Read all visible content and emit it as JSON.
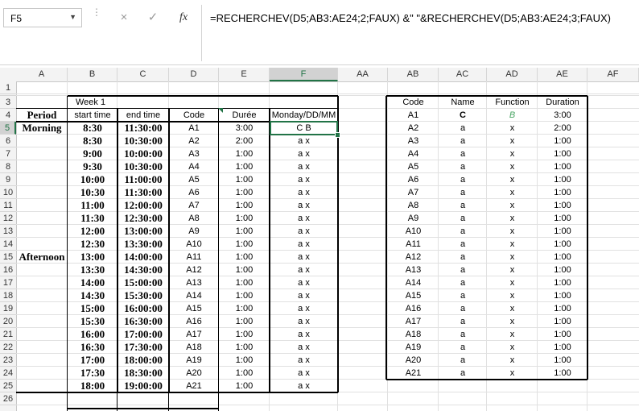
{
  "formula_bar": {
    "name_box": "F5",
    "cancel_icon": "×",
    "enter_icon": "✓",
    "fx_label": "fx",
    "formula": "=RECHERCHEV(D5;AB3:AE24;2;FAUX) &\"  \"&RECHERCHEV(D5;AB3:AE24;3;FAUX)"
  },
  "columns": [
    "A",
    "B",
    "C",
    "D",
    "E",
    "F",
    "AA",
    "AB",
    "AC",
    "AD",
    "AE",
    "AF"
  ],
  "rows": [
    "1",
    "2",
    "3",
    "4",
    "5",
    "6",
    "7",
    "8",
    "9",
    "10",
    "11",
    "12",
    "13",
    "14",
    "15",
    "16",
    "17",
    "18",
    "19",
    "20",
    "21",
    "22",
    "23",
    "24",
    "25",
    "26"
  ],
  "selected_cell": {
    "column": "F",
    "row": "5"
  },
  "schedule": {
    "week_label": "Week 1",
    "headers": {
      "period": "Period",
      "start": "start time",
      "end": "end time",
      "code": "Code",
      "duration": "Durée",
      "day": "Monday/DD/MM"
    },
    "period_labels": [
      {
        "row": "5",
        "label": "Morning"
      },
      {
        "row": "15",
        "label": "Afternoon"
      }
    ],
    "rows": [
      {
        "start": "8:30",
        "end": "11:30:00",
        "code": "A1",
        "duration": "3:00",
        "value": "C B"
      },
      {
        "start": "8:30",
        "end": "10:30:00",
        "code": "A2",
        "duration": "2:00",
        "value": "a x"
      },
      {
        "start": "9:00",
        "end": "10:00:00",
        "code": "A3",
        "duration": "1:00",
        "value": "a x"
      },
      {
        "start": "9:30",
        "end": "10:30:00",
        "code": "A4",
        "duration": "1:00",
        "value": "a x"
      },
      {
        "start": "10:00",
        "end": "11:00:00",
        "code": "A5",
        "duration": "1:00",
        "value": "a x"
      },
      {
        "start": "10:30",
        "end": "11:30:00",
        "code": "A6",
        "duration": "1:00",
        "value": "a x"
      },
      {
        "start": "11:00",
        "end": "12:00:00",
        "code": "A7",
        "duration": "1:00",
        "value": "a x"
      },
      {
        "start": "11:30",
        "end": "12:30:00",
        "code": "A8",
        "duration": "1:00",
        "value": "a x"
      },
      {
        "start": "12:00",
        "end": "13:00:00",
        "code": "A9",
        "duration": "1:00",
        "value": "a x"
      },
      {
        "start": "12:30",
        "end": "13:30:00",
        "code": "A10",
        "duration": "1:00",
        "value": "a x"
      },
      {
        "start": "13:00",
        "end": "14:00:00",
        "code": "A11",
        "duration": "1:00",
        "value": "a x"
      },
      {
        "start": "13:30",
        "end": "14:30:00",
        "code": "A12",
        "duration": "1:00",
        "value": "a x"
      },
      {
        "start": "14:00",
        "end": "15:00:00",
        "code": "A13",
        "duration": "1:00",
        "value": "a x"
      },
      {
        "start": "14:30",
        "end": "15:30:00",
        "code": "A14",
        "duration": "1:00",
        "value": "a x"
      },
      {
        "start": "15:00",
        "end": "16:00:00",
        "code": "A15",
        "duration": "1:00",
        "value": "a x"
      },
      {
        "start": "15:30",
        "end": "16:30:00",
        "code": "A16",
        "duration": "1:00",
        "value": "a x"
      },
      {
        "start": "16:00",
        "end": "17:00:00",
        "code": "A17",
        "duration": "1:00",
        "value": "a x"
      },
      {
        "start": "16:30",
        "end": "17:30:00",
        "code": "A18",
        "duration": "1:00",
        "value": "a x"
      },
      {
        "start": "17:00",
        "end": "18:00:00",
        "code": "A19",
        "duration": "1:00",
        "value": "a x"
      },
      {
        "start": "17:30",
        "end": "18:30:00",
        "code": "A20",
        "duration": "1:00",
        "value": "a x"
      },
      {
        "start": "18:00",
        "end": "19:00:00",
        "code": "A21",
        "duration": "1:00",
        "value": "a x"
      }
    ]
  },
  "lookup": {
    "headers": {
      "code": "Code",
      "name": "Name",
      "function": "Function",
      "duration": "Duration"
    },
    "rows": [
      {
        "code": "A1",
        "name": "C",
        "function": "B",
        "duration": "3:00"
      },
      {
        "code": "A2",
        "name": "a",
        "function": "x",
        "duration": "2:00"
      },
      {
        "code": "A3",
        "name": "a",
        "function": "x",
        "duration": "1:00"
      },
      {
        "code": "A4",
        "name": "a",
        "function": "x",
        "duration": "1:00"
      },
      {
        "code": "A5",
        "name": "a",
        "function": "x",
        "duration": "1:00"
      },
      {
        "code": "A6",
        "name": "a",
        "function": "x",
        "duration": "1:00"
      },
      {
        "code": "A7",
        "name": "a",
        "function": "x",
        "duration": "1:00"
      },
      {
        "code": "A8",
        "name": "a",
        "function": "x",
        "duration": "1:00"
      },
      {
        "code": "A9",
        "name": "a",
        "function": "x",
        "duration": "1:00"
      },
      {
        "code": "A10",
        "name": "a",
        "function": "x",
        "duration": "1:00"
      },
      {
        "code": "A11",
        "name": "a",
        "function": "x",
        "duration": "1:00"
      },
      {
        "code": "A12",
        "name": "a",
        "function": "x",
        "duration": "1:00"
      },
      {
        "code": "A13",
        "name": "a",
        "function": "x",
        "duration": "1:00"
      },
      {
        "code": "A14",
        "name": "a",
        "function": "x",
        "duration": "1:00"
      },
      {
        "code": "A15",
        "name": "a",
        "function": "x",
        "duration": "1:00"
      },
      {
        "code": "A16",
        "name": "a",
        "function": "x",
        "duration": "1:00"
      },
      {
        "code": "A17",
        "name": "a",
        "function": "x",
        "duration": "1:00"
      },
      {
        "code": "A18",
        "name": "a",
        "function": "x",
        "duration": "1:00"
      },
      {
        "code": "A19",
        "name": "a",
        "function": "x",
        "duration": "1:00"
      },
      {
        "code": "A20",
        "name": "a",
        "function": "x",
        "duration": "1:00"
      },
      {
        "code": "A21",
        "name": "a",
        "function": "x",
        "duration": "1:00"
      }
    ]
  },
  "colors": {
    "excel_green": "#217346",
    "function_highlight": "#4aa564"
  }
}
